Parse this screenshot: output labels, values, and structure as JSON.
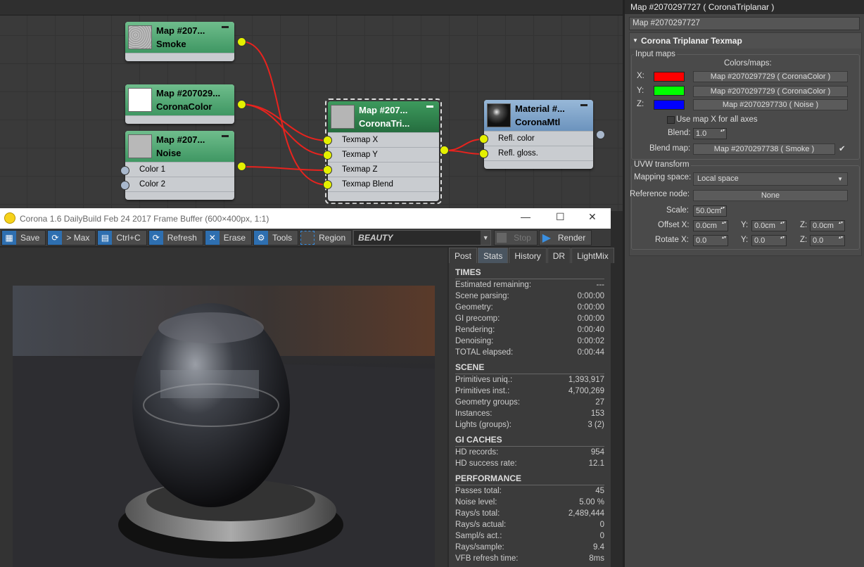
{
  "nodes": {
    "smoke": {
      "line1": "Map  #207...",
      "line2": "Smoke"
    },
    "coronacolor": {
      "line1": "Map  #207029...",
      "line2": "CoronaColor"
    },
    "noise": {
      "line1": "Map  #207...",
      "line2": "Noise",
      "slots": [
        "Color 1",
        "Color 2"
      ]
    },
    "triplanar": {
      "line1": "Map  #207...",
      "line2": "CoronaTri...",
      "slots": [
        "Texmap X",
        "Texmap Y",
        "Texmap Z",
        "Texmap Blend"
      ]
    },
    "material": {
      "line1": "Material  #...",
      "line2": "CoronaMtl",
      "slots": [
        "Refl. color",
        "Refl. gloss."
      ]
    }
  },
  "vfb": {
    "title": "Corona 1.6 DailyBuild Feb 24 2017 Frame Buffer (600×400px, 1:1)",
    "toolbar": {
      "save": "Save",
      "max": "> Max",
      "copy": "Ctrl+C",
      "refresh": "Refresh",
      "erase": "Erase",
      "tools": "Tools",
      "region": "Region",
      "channel": "BEAUTY",
      "stop": "Stop",
      "render": "Render"
    },
    "tabs": [
      "Post",
      "Stats",
      "History",
      "DR",
      "LightMix"
    ],
    "stats": {
      "times": {
        "title": "TIMES",
        "rows": [
          [
            "Estimated remaining:",
            "---"
          ],
          [
            "Scene parsing:",
            "0:00:00"
          ],
          [
            "Geometry:",
            "0:00:00"
          ],
          [
            "GI precomp:",
            "0:00:00"
          ],
          [
            "Rendering:",
            "0:00:40"
          ],
          [
            "Denoising:",
            "0:00:02"
          ],
          [
            "TOTAL elapsed:",
            "0:00:44"
          ]
        ]
      },
      "scene": {
        "title": "SCENE",
        "rows": [
          [
            "Primitives uniq.:",
            "1,393,917"
          ],
          [
            "Primitives inst.:",
            "4,700,269"
          ],
          [
            "Geometry groups:",
            "27"
          ],
          [
            "Instances:",
            "153"
          ],
          [
            "Lights (groups):",
            "3 (2)"
          ]
        ]
      },
      "gi": {
        "title": "GI CACHES",
        "rows": [
          [
            "HD records:",
            "954"
          ],
          [
            "HD success rate:",
            "12.1"
          ]
        ]
      },
      "perf": {
        "title": "PERFORMANCE",
        "rows": [
          [
            "Passes total:",
            "45"
          ],
          [
            "Noise level:",
            "5.00 %"
          ],
          [
            "Rays/s total:",
            "2,489,444"
          ],
          [
            "Rays/s actual:",
            "0"
          ],
          [
            "Sampl/s act.:",
            "0"
          ],
          [
            "Rays/sample:",
            "9.4"
          ],
          [
            "VFB refresh time:",
            "8ms"
          ]
        ]
      }
    }
  },
  "panel": {
    "title": "Map #2070297727  ( CoronaTriplanar )",
    "name": "Map #2070297727",
    "rollout": "Corona Triplanar Texmap",
    "input_maps": "Input maps",
    "colors_maps": "Colors/maps:",
    "x_label": "X:",
    "y_label": "Y:",
    "z_label": "Z:",
    "x_map": "Map #2070297729  ( CoronaColor )",
    "y_map": "Map #2070297729  ( CoronaColor )",
    "z_map": "Map #2070297730  ( Noise )",
    "x_color": "#ff0000",
    "y_color": "#00ff00",
    "z_color": "#0000ff",
    "use_map_x": "Use map X for all axes",
    "blend_label": "Blend:",
    "blend_value": "1.0",
    "blend_map_label": "Blend map:",
    "blend_map": "Map #2070297738  ( Smoke )",
    "blend_check": "✔",
    "uvw": "UVW transform",
    "mapping_label": "Mapping space:",
    "mapping_value": "Local space",
    "ref_label": "Reference node:",
    "ref_value": "None",
    "scale_label": "Scale:",
    "scale_value": "50.0cm",
    "offset_label": "Offset X:",
    "offset_x": "0.0cm",
    "offset_y": "0.0cm",
    "offset_z": "0.0cm",
    "rotate_label": "Rotate X:",
    "rotate_x": "0.0",
    "rotate_y": "0.0",
    "rotate_z": "0.0",
    "y_axis": "Y:",
    "z_axis": "Z:"
  }
}
